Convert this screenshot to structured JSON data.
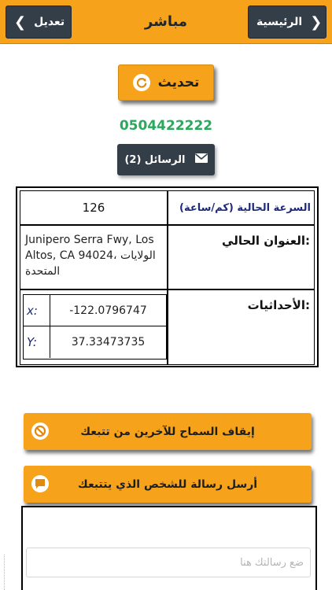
{
  "header": {
    "title": "مباشر",
    "left_button_label": "تعديل",
    "right_button_label": "الرئيسية"
  },
  "refresh_label": "تحديث",
  "phone_number": "0504422222",
  "messages_label": "الرسائل (2)",
  "info": {
    "speed_label": "السرعة الحالية (كم/ساعة)",
    "speed_value": "126",
    "address_label": "العنوان الحالي:",
    "address_value": "Junipero Serra Fwy, Los Altos, CA 94024، الولايات المتحدة",
    "coordinates_label": "الأحداثيات:",
    "x_label": "x:",
    "x_value": "-122.0796747",
    "y_label": "Y:",
    "y_value": "37.33473735"
  },
  "actions": {
    "stop_label": "إيقاف السماح للآخرين من تتبعك",
    "send_label": "أرسل رسالة للشخص الذي يتتبعك"
  },
  "message_box": {
    "placeholder": "ضع رسالتك هنا"
  },
  "colors": {
    "accent": "#f7a21b",
    "dark": "#343e49",
    "phone": "#2aa85d",
    "label_blue": "#1e2a78"
  },
  "icons": {
    "refresh": "refresh-icon",
    "envelope": "envelope-icon",
    "prohibit": "prohibit-icon",
    "chat": "chat-bubble-icon",
    "chevron_left": "chevron-left-icon",
    "chevron_right": "chevron-right-icon"
  }
}
